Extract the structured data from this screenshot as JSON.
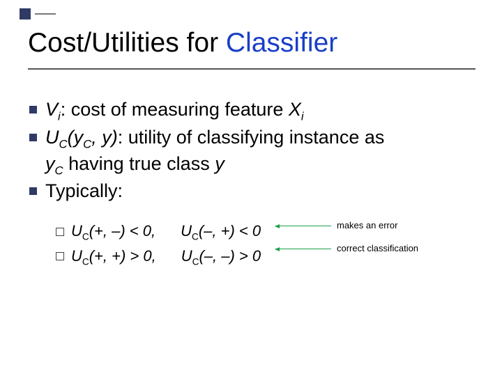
{
  "title_part1": "Cost/Utilities for ",
  "title_part2": "Classifier",
  "bullets": {
    "b1_pre": "V",
    "b1_sub": "i",
    "b1_mid": ": cost of measuring feature ",
    "b1_x": "X",
    "b1_xsub": "i",
    "b2_u": "U",
    "b2_csub": "C",
    "b2_args_open": "(y",
    "b2_args_csub": "C",
    "b2_args_rest": ", y)",
    "b2_desc1": ": utility of classifying instance as",
    "b2_y": "y",
    "b2_ycsub": "C",
    "b2_desc2": " having true class ",
    "b2_yvar": "y",
    "b3": "Typically:"
  },
  "sub": {
    "r1c1_pre": "U",
    "r1c1_sub": "C",
    "r1c1_rest": "(+, –) < 0,",
    "r1c2_pre": "U",
    "r1c2_sub": "C",
    "r1c2_rest": "(–, +) < 0",
    "r2c1_pre": "U",
    "r2c1_sub": "C",
    "r2c1_rest": "(+, +) > 0,",
    "r2c2_pre": "U",
    "r2c2_sub": "C",
    "r2c2_rest": "(–, –) > 0"
  },
  "annotations": {
    "error": "makes an error",
    "correct": "correct classification"
  }
}
